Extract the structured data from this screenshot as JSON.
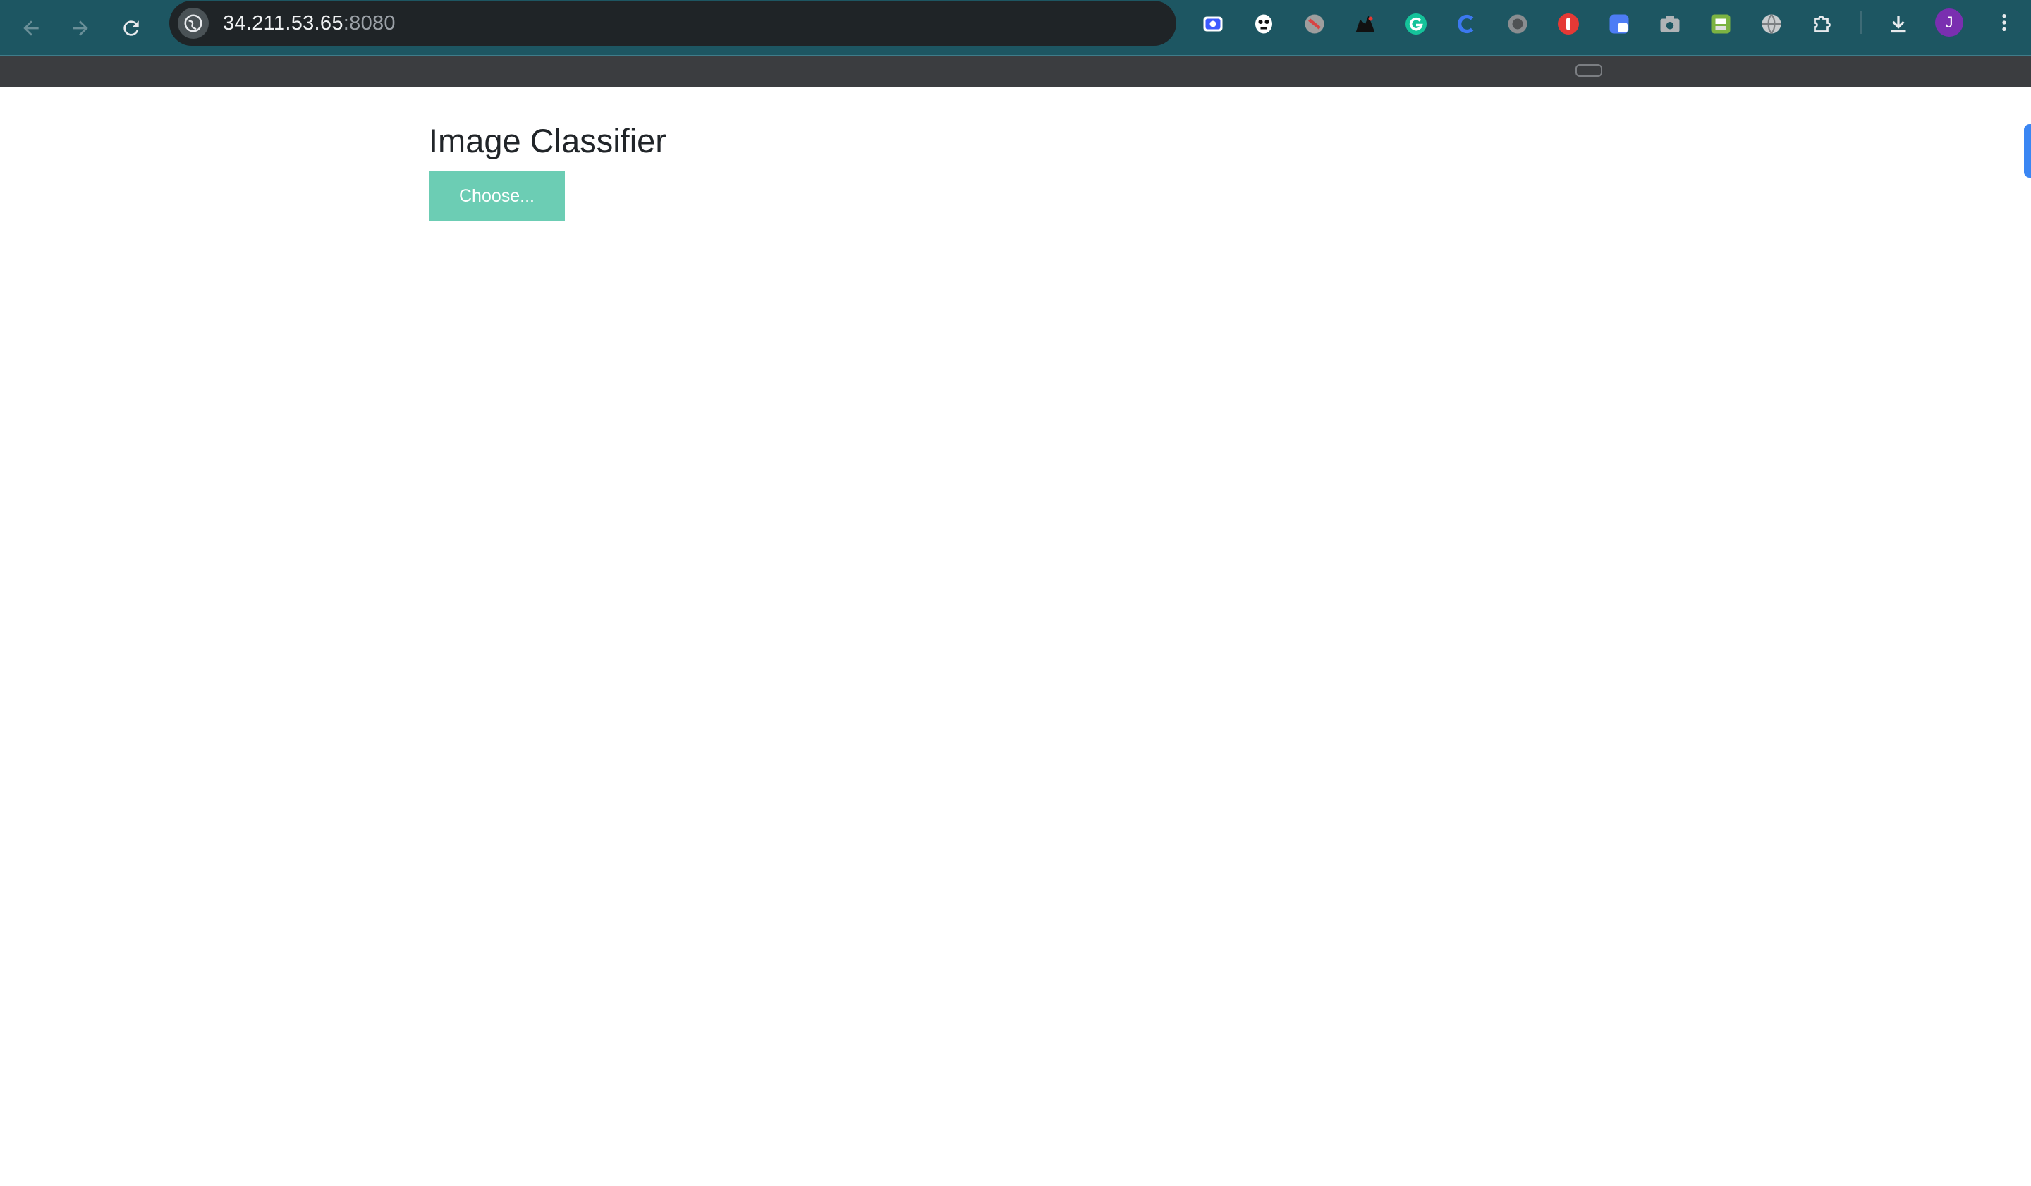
{
  "browser": {
    "url_host": "34.211.53.65",
    "url_port": ":8080",
    "avatar_initial": "J",
    "extensions": [
      "screen-capture-extension-icon",
      "mask-extension-icon",
      "disc-extension-icon",
      "dark-graphics-extension-icon",
      "grammarly-icon",
      "c-extension-icon",
      "grey-circle-extension-icon",
      "stop-hand-extension-icon",
      "blue-square-extension-icon",
      "camera-extension-icon",
      "printer-extension-icon",
      "globe-extension-icon",
      "puzzle-extensions-icon"
    ]
  },
  "page": {
    "title": "Image Classifier",
    "choose_label": "Choose..."
  },
  "colors": {
    "toolbar": "#1d5662",
    "button": "#6ccdb4",
    "title_text": "#212529"
  }
}
